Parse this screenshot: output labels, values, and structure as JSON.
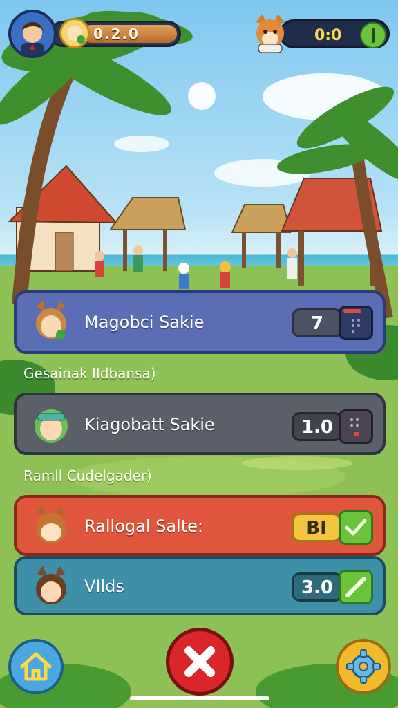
{
  "hud": {
    "player_score": "0.2.0",
    "opponent_score": "0:0"
  },
  "rows": [
    {
      "label": "Magobci Sakie",
      "value": "7"
    },
    {
      "label": "Kiagobatt Sakie",
      "value": "1.0"
    },
    {
      "label": "Rallogal Salte:",
      "value": "BI"
    },
    {
      "label": "VIlds",
      "value": "3.0"
    }
  ],
  "subtitles": [
    "Gesainak IIdbansa)",
    "Ramll Cudelgader)"
  ],
  "colors": {
    "row1": "#5a6db5",
    "row2": "#5b5f6a",
    "row3": "#e0563c",
    "row4": "#3e8fa8",
    "close_button": "#d8262a",
    "settings_button": "#f2b92a",
    "home_button": "#4aa8df"
  },
  "icons": {
    "home": "home-icon",
    "close": "close-icon",
    "settings": "gear-icon"
  }
}
